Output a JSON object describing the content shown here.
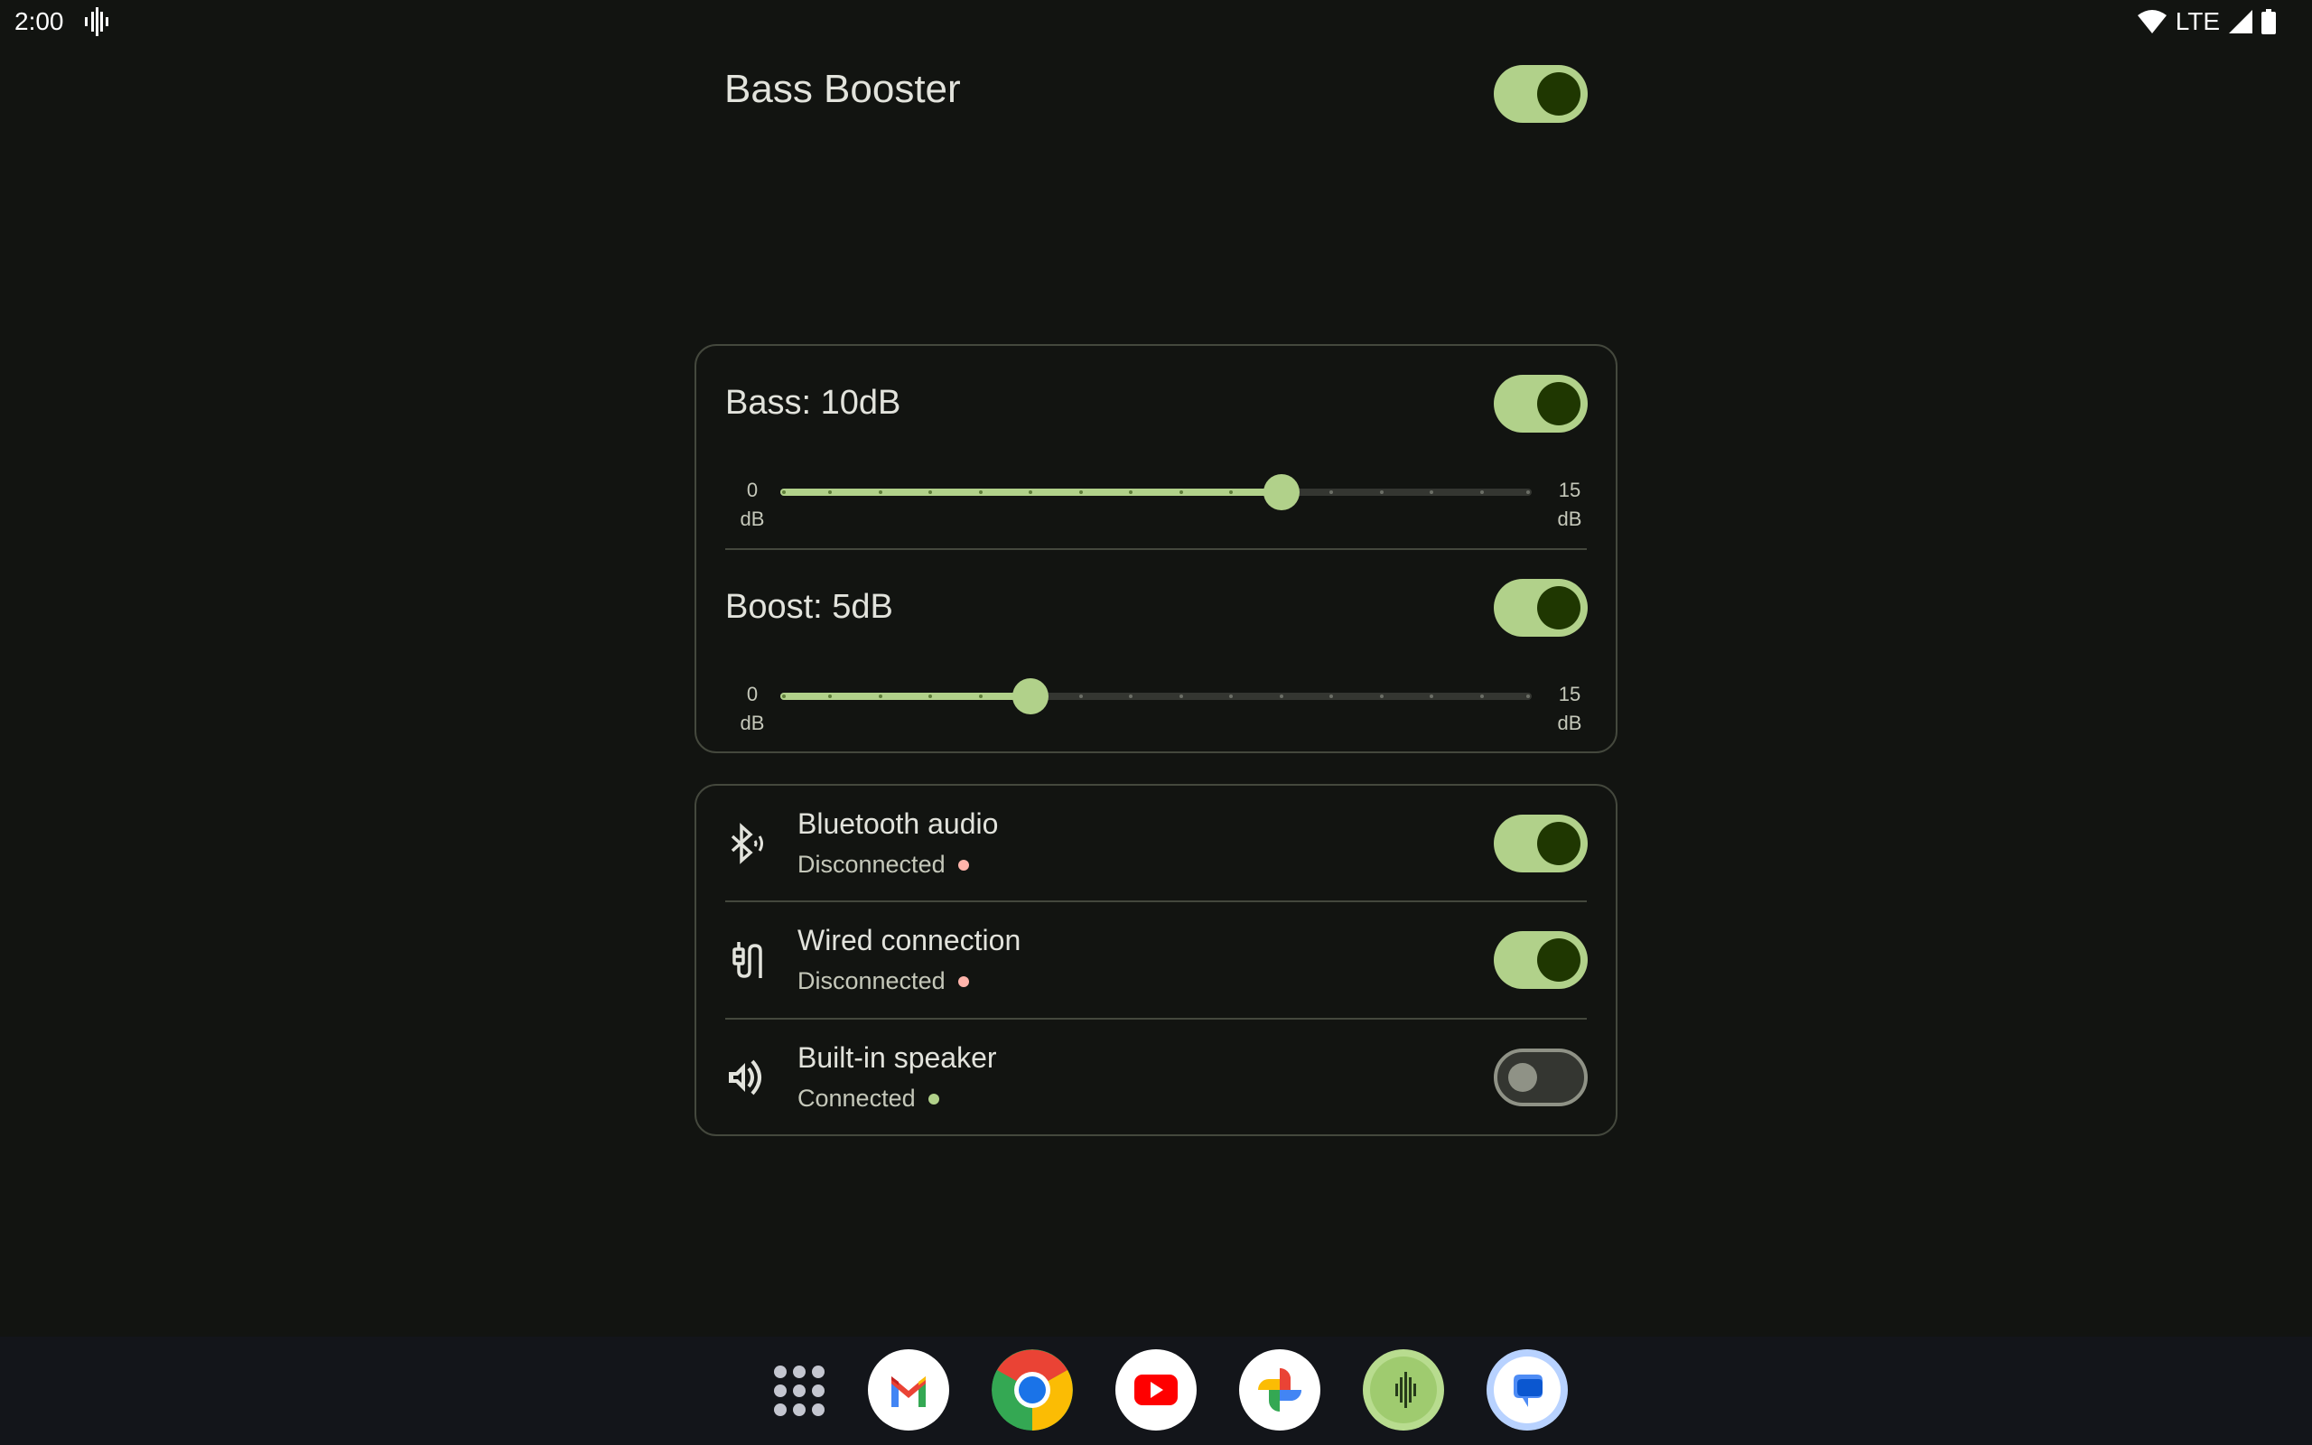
{
  "status_bar": {
    "time": "2:00",
    "left_icons": [
      "audio-waveform-icon"
    ],
    "network_label": "LTE",
    "right_icons": [
      "wifi-icon",
      "cell-signal-icon",
      "battery-icon"
    ]
  },
  "header": {
    "title": "Bass Booster",
    "enabled": true
  },
  "equalizer": {
    "bass": {
      "label": "Bass: 10dB",
      "enabled": true,
      "value_db": 10,
      "min_label": "0",
      "min_unit": "dB",
      "max_label": "15",
      "max_unit": "dB",
      "min": 0,
      "max": 15,
      "step": 1
    },
    "boost": {
      "label": "Boost: 5dB",
      "enabled": true,
      "value_db": 5,
      "min_label": "0",
      "min_unit": "dB",
      "max_label": "15",
      "max_unit": "dB",
      "min": 0,
      "max": 15,
      "step": 1
    }
  },
  "outputs": [
    {
      "icon": "bluetooth-audio-icon",
      "title": "Bluetooth audio",
      "status": "Disconnected",
      "status_color": "#ffb4ab",
      "enabled": true
    },
    {
      "icon": "wired-connection-icon",
      "title": "Wired connection",
      "status": "Disconnected",
      "status_color": "#ffb4ab",
      "enabled": true
    },
    {
      "icon": "speaker-icon",
      "title": "Built-in speaker",
      "status": "Connected",
      "status_color": "#b1d18a",
      "enabled": false
    }
  ],
  "dock": {
    "items": [
      "app-drawer",
      "Gmail",
      "Chrome",
      "YouTube",
      "Google Photos",
      "Bass Booster",
      "Messages"
    ]
  },
  "colors": {
    "accent": "#b1d18a",
    "accent_dark": "#1f3701",
    "background": "#121411",
    "outline": "#44483d"
  }
}
